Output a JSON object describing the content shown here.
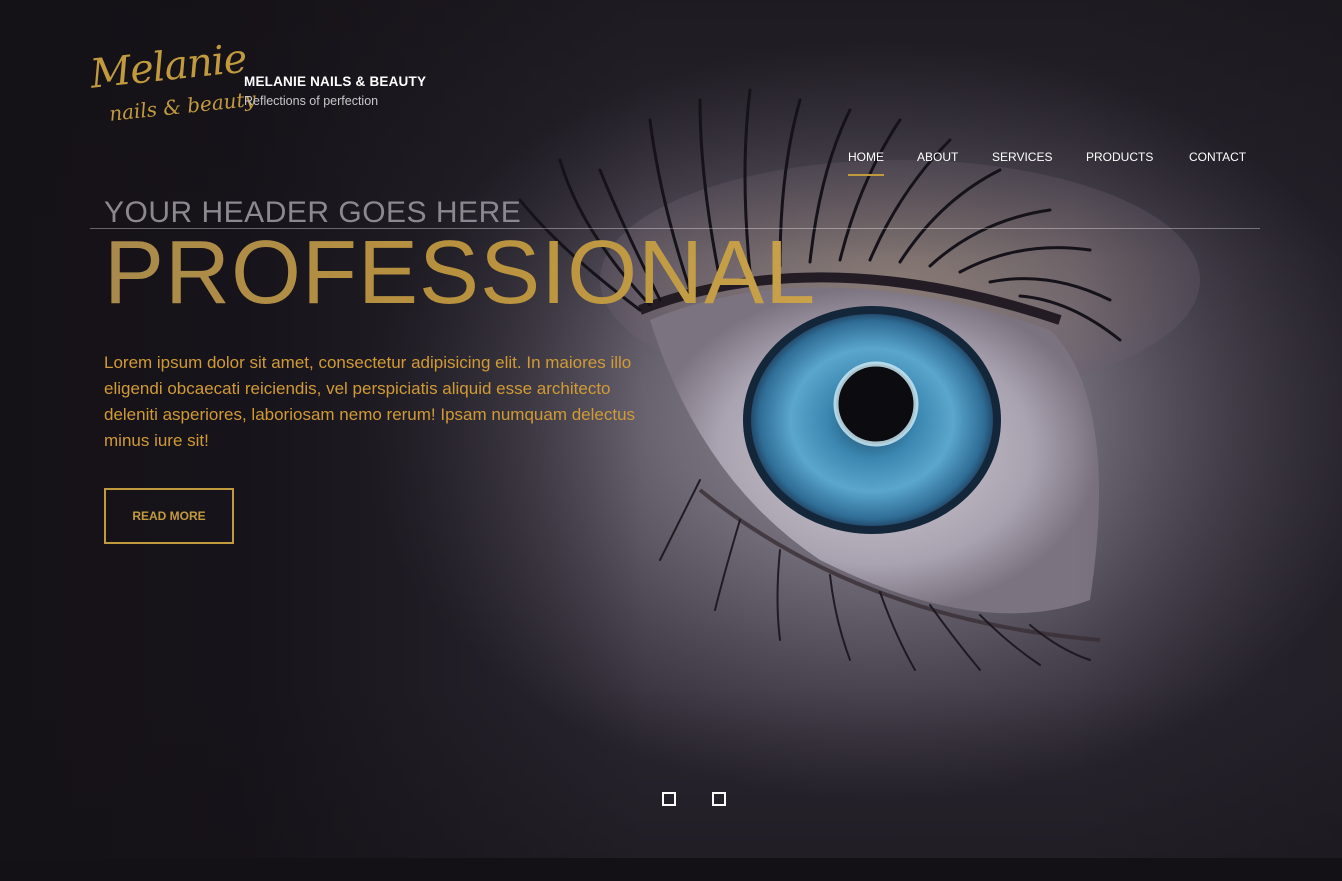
{
  "brand": {
    "logo_script_line1": "Melanie",
    "logo_script_line2": "nails & beauty",
    "name": "MELANIE NAILS & BEAUTY",
    "tagline": "Reflections of perfection"
  },
  "nav": {
    "items": [
      {
        "label": "HOME",
        "active": true
      },
      {
        "label": "ABOUT",
        "active": false
      },
      {
        "label": "SERVICES",
        "active": false
      },
      {
        "label": "PRODUCTS",
        "active": false
      },
      {
        "label": "CONTACT",
        "active": false
      }
    ]
  },
  "hero": {
    "kicker": "YOUR HEADER GOES HERE",
    "headline": "PROFESSIONAL",
    "body": "Lorem ipsum dolor sit amet, consectetur adipisicing elit. In maiores illo eligendi obcaecati reiciendis, vel perspiciatis aliquid esse architecto deleniti asperiores, laboriosam nemo rerum! Ipsam numquam delectus minus iure sit!",
    "cta_label": "READ MORE",
    "background_image": "close-up blue eye"
  },
  "slider": {
    "slide_count": 2
  },
  "colors": {
    "accent": "#c29a3e",
    "background": "#141116",
    "body_text": "#d19a35"
  }
}
